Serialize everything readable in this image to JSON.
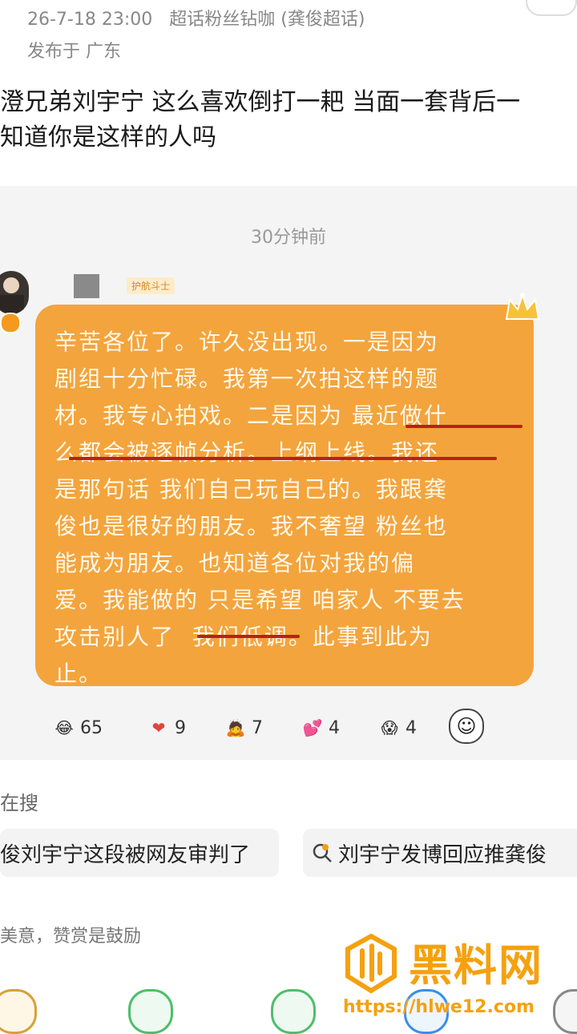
{
  "post": {
    "date": "26-7-18 23:00",
    "source": "超话粉丝钻咖 (龚俊超话)",
    "location": "发布于 广东",
    "text_line1": "澄兄弟刘宇宁  这么喜欢倒打一耙 当面一套背后一",
    "text_line2": "知道你是这样的人吗"
  },
  "screenshot_card": {
    "time": "30分钟前",
    "tag": "护航斗士",
    "message": "辛苦各位了。许久没出现。一是因为\n剧组十分忙碌。我第一次拍这样的题\n材。我专心拍戏。二是因为 最近做什\n么都会被逐帧分析。上纲上线。我还\n是那句话 我们自己玩自己的。我跟龚\n俊也是很好的朋友。我不奢望 粉丝也\n能成为朋友。也知道各位对我的偏\n爱。我能做的 只是希望 咱家人 不要去\n攻击别人了  我们低调。此事到此为\n止。",
    "reactions": [
      {
        "icon": "laugh-cry-emoji-icon",
        "glyph": "😂",
        "count": "65"
      },
      {
        "icon": "heart-icon",
        "glyph": "❤",
        "count": "9"
      },
      {
        "icon": "bow-emoji-icon",
        "glyph": "🙇",
        "count": "7"
      },
      {
        "icon": "hearts-emoji-icon",
        "glyph": "💕",
        "count": "4"
      },
      {
        "icon": "shocked-emoji-icon",
        "glyph": "😱",
        "count": "4"
      }
    ]
  },
  "search": {
    "heading": "在搜",
    "chips": [
      "俊刘宇宁这段被网友审判了",
      "刘宇宁发博回应推龚俊"
    ]
  },
  "reward_text": "美意，赞赏是鼓励",
  "watermark": {
    "title": "黑料网",
    "url": "https://hlwe12.com"
  },
  "colors": {
    "bubble": "#f3a43d",
    "underline": "#b8211c",
    "watermark": "#f5a10f"
  }
}
